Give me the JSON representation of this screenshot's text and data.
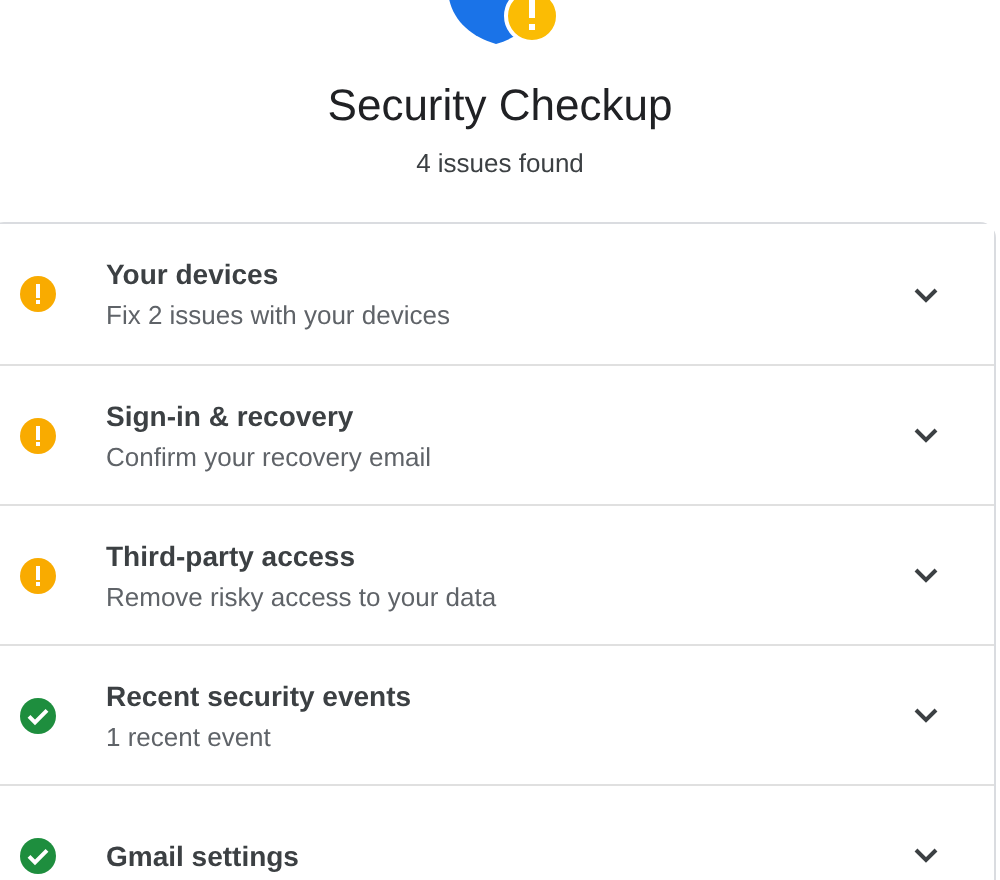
{
  "header": {
    "title": "Security Checkup",
    "subtitle": "4 issues found"
  },
  "items": [
    {
      "kind": "warning",
      "title": "Your devices",
      "description": "Fix 2 issues with your devices",
      "expanded": false
    },
    {
      "kind": "warning",
      "title": "Sign-in & recovery",
      "description": "Confirm your recovery email",
      "expanded": false
    },
    {
      "kind": "warning",
      "title": "Third-party access",
      "description": "Remove risky access to your data",
      "expanded": false
    },
    {
      "kind": "ok",
      "title": "Recent security events",
      "description": "1 recent event",
      "expanded": false
    },
    {
      "kind": "ok",
      "title": "Gmail settings",
      "expanded": false
    }
  ]
}
